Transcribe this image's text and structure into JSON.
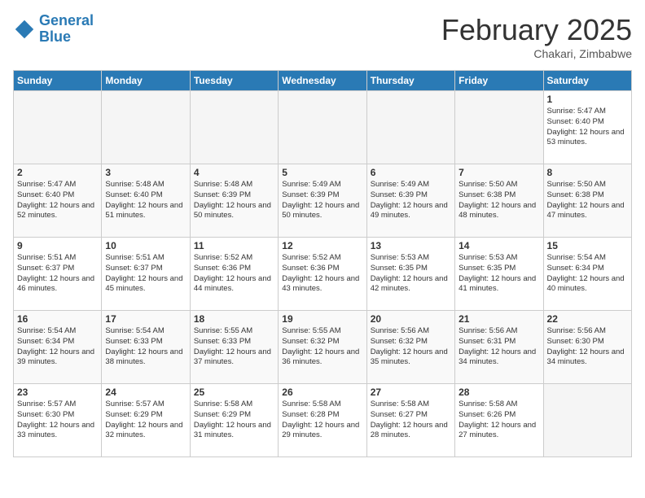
{
  "header": {
    "logo_general": "General",
    "logo_blue": "Blue",
    "month_title": "February 2025",
    "subtitle": "Chakari, Zimbabwe"
  },
  "days_of_week": [
    "Sunday",
    "Monday",
    "Tuesday",
    "Wednesday",
    "Thursday",
    "Friday",
    "Saturday"
  ],
  "weeks": [
    [
      {
        "day": "",
        "info": ""
      },
      {
        "day": "",
        "info": ""
      },
      {
        "day": "",
        "info": ""
      },
      {
        "day": "",
        "info": ""
      },
      {
        "day": "",
        "info": ""
      },
      {
        "day": "",
        "info": ""
      },
      {
        "day": "1",
        "info": "Sunrise: 5:47 AM\nSunset: 6:40 PM\nDaylight: 12 hours\nand 53 minutes."
      }
    ],
    [
      {
        "day": "2",
        "info": "Sunrise: 5:47 AM\nSunset: 6:40 PM\nDaylight: 12 hours\nand 52 minutes."
      },
      {
        "day": "3",
        "info": "Sunrise: 5:48 AM\nSunset: 6:40 PM\nDaylight: 12 hours\nand 51 minutes."
      },
      {
        "day": "4",
        "info": "Sunrise: 5:48 AM\nSunset: 6:39 PM\nDaylight: 12 hours\nand 50 minutes."
      },
      {
        "day": "5",
        "info": "Sunrise: 5:49 AM\nSunset: 6:39 PM\nDaylight: 12 hours\nand 50 minutes."
      },
      {
        "day": "6",
        "info": "Sunrise: 5:49 AM\nSunset: 6:39 PM\nDaylight: 12 hours\nand 49 minutes."
      },
      {
        "day": "7",
        "info": "Sunrise: 5:50 AM\nSunset: 6:38 PM\nDaylight: 12 hours\nand 48 minutes."
      },
      {
        "day": "8",
        "info": "Sunrise: 5:50 AM\nSunset: 6:38 PM\nDaylight: 12 hours\nand 47 minutes."
      }
    ],
    [
      {
        "day": "9",
        "info": "Sunrise: 5:51 AM\nSunset: 6:37 PM\nDaylight: 12 hours\nand 46 minutes."
      },
      {
        "day": "10",
        "info": "Sunrise: 5:51 AM\nSunset: 6:37 PM\nDaylight: 12 hours\nand 45 minutes."
      },
      {
        "day": "11",
        "info": "Sunrise: 5:52 AM\nSunset: 6:36 PM\nDaylight: 12 hours\nand 44 minutes."
      },
      {
        "day": "12",
        "info": "Sunrise: 5:52 AM\nSunset: 6:36 PM\nDaylight: 12 hours\nand 43 minutes."
      },
      {
        "day": "13",
        "info": "Sunrise: 5:53 AM\nSunset: 6:35 PM\nDaylight: 12 hours\nand 42 minutes."
      },
      {
        "day": "14",
        "info": "Sunrise: 5:53 AM\nSunset: 6:35 PM\nDaylight: 12 hours\nand 41 minutes."
      },
      {
        "day": "15",
        "info": "Sunrise: 5:54 AM\nSunset: 6:34 PM\nDaylight: 12 hours\nand 40 minutes."
      }
    ],
    [
      {
        "day": "16",
        "info": "Sunrise: 5:54 AM\nSunset: 6:34 PM\nDaylight: 12 hours\nand 39 minutes."
      },
      {
        "day": "17",
        "info": "Sunrise: 5:54 AM\nSunset: 6:33 PM\nDaylight: 12 hours\nand 38 minutes."
      },
      {
        "day": "18",
        "info": "Sunrise: 5:55 AM\nSunset: 6:33 PM\nDaylight: 12 hours\nand 37 minutes."
      },
      {
        "day": "19",
        "info": "Sunrise: 5:55 AM\nSunset: 6:32 PM\nDaylight: 12 hours\nand 36 minutes."
      },
      {
        "day": "20",
        "info": "Sunrise: 5:56 AM\nSunset: 6:32 PM\nDaylight: 12 hours\nand 35 minutes."
      },
      {
        "day": "21",
        "info": "Sunrise: 5:56 AM\nSunset: 6:31 PM\nDaylight: 12 hours\nand 34 minutes."
      },
      {
        "day": "22",
        "info": "Sunrise: 5:56 AM\nSunset: 6:30 PM\nDaylight: 12 hours\nand 34 minutes."
      }
    ],
    [
      {
        "day": "23",
        "info": "Sunrise: 5:57 AM\nSunset: 6:30 PM\nDaylight: 12 hours\nand 33 minutes."
      },
      {
        "day": "24",
        "info": "Sunrise: 5:57 AM\nSunset: 6:29 PM\nDaylight: 12 hours\nand 32 minutes."
      },
      {
        "day": "25",
        "info": "Sunrise: 5:58 AM\nSunset: 6:29 PM\nDaylight: 12 hours\nand 31 minutes."
      },
      {
        "day": "26",
        "info": "Sunrise: 5:58 AM\nSunset: 6:28 PM\nDaylight: 12 hours\nand 29 minutes."
      },
      {
        "day": "27",
        "info": "Sunrise: 5:58 AM\nSunset: 6:27 PM\nDaylight: 12 hours\nand 28 minutes."
      },
      {
        "day": "28",
        "info": "Sunrise: 5:58 AM\nSunset: 6:26 PM\nDaylight: 12 hours\nand 27 minutes."
      },
      {
        "day": "",
        "info": ""
      }
    ]
  ]
}
